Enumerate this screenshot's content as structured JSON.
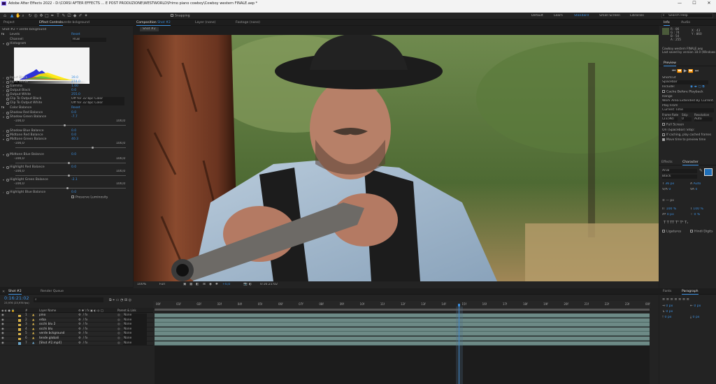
{
  "window": {
    "title": "Adobe After Effects 2022 - D:\\CORSI AFTER EFFECTS ... E POST PRODUZIONE\\WESTWORLD\\Primo piano cowboy\\Cowboy western FINALE.aep *",
    "minimize": "—",
    "maximize": "☐",
    "close": "✕"
  },
  "menu": [
    "File",
    "Edit",
    "Composition",
    "Layer",
    "Effect",
    "Animation",
    "View",
    "Window",
    "Help"
  ],
  "toolbar": {
    "snapping": "Snapping",
    "workspaces": [
      "Default",
      "Learn",
      "Standard",
      "Small Screen",
      "Libraries"
    ],
    "search_placeholder": "Search Help"
  },
  "left": {
    "tabs": [
      "Project",
      "Effect Controls",
      "verde bckground"
    ],
    "header": "Shot #2 • verde bckground",
    "effect_levels": "Levels",
    "reset": "Reset",
    "channel_label": "Channel:",
    "channel_value": "RGB",
    "histogram_label": "Histogram",
    "rows": [
      {
        "label": "Input Black",
        "value": "39.0"
      },
      {
        "label": "Input White",
        "value": "274.0"
      },
      {
        "label": "Gamma",
        "value": "1.00"
      },
      {
        "label": "Output Black",
        "value": "0.0"
      },
      {
        "label": "Output White",
        "value": "255.0"
      },
      {
        "label": "Clip To Output Black",
        "value": "Off for 32 bpc Color"
      },
      {
        "label": "Clip To Output White",
        "value": "Off for 32 bpc Color"
      }
    ],
    "effect_color_balance": "Color Balance",
    "reset2": "Reset",
    "cb_rows": [
      {
        "label": "Shadow Red Balance",
        "value": "0.0"
      },
      {
        "label": "Shadow Green Balance",
        "value": "-7.7"
      },
      {
        "label": "Shadow Blue Balance",
        "value": "0.0"
      },
      {
        "label": "Midtone Red Balance",
        "value": "0.0"
      },
      {
        "label": "Midtone Green Balance",
        "value": "40.3"
      },
      {
        "label": "Midtone Blue Balance",
        "value": "0.0"
      },
      {
        "label": "Highlight Red Balance",
        "value": "0.0"
      },
      {
        "label": "Highlight Green Balance",
        "value": "-2.1"
      },
      {
        "label": "Highlight Blue Balance",
        "value": "0.0"
      }
    ],
    "min": "-100,0",
    "max": "100,0",
    "preserve": "Preserve Luminosity"
  },
  "comp": {
    "tabs": [
      "Composition",
      "Shot #2",
      "Layer (none)",
      "Footage (none)"
    ],
    "subtab": "Shot #2",
    "zoom": "100%",
    "res": "Full",
    "timecode": "0:16:21:02",
    "exposure": "+0,0"
  },
  "right": {
    "info_tabs": [
      "Info",
      "Audio"
    ],
    "info_lines": [
      "R : 86",
      "G : 74",
      "B : 54",
      "A : 255"
    ],
    "xy": [
      "X : 43",
      "Y : 860"
    ],
    "file": "Cowboy western FINALE.aep",
    "saved": "Last saved by version 18.0 (Windows 6",
    "preview_tab": "Preview",
    "shortcut_label": "Shortcut",
    "shortcut": "Spacebar",
    "include": "Include:",
    "cache": "Cache Before Playback",
    "range_label": "Range",
    "range": "Work Area Extended By Current...",
    "playfrom_label": "Play From",
    "playfrom": "Current Time",
    "fr_label": "Frame Rate",
    "skip_label": "Skip",
    "resolution_label": "Resolution",
    "fr": "(23,98)",
    "skip": "0",
    "resolution": "Auto",
    "fullscreen": "Full Screen",
    "stop_label": "On (Spacebar) Stop:",
    "stop1": "If caching, play cached frames",
    "stop2": "Move time to preview time",
    "char_tabs": [
      "Effects",
      "Character"
    ],
    "font": "Arial",
    "style": "Black",
    "size": "36 px",
    "leading": "Auto",
    "kerning": "0",
    "tracking": "0",
    "unit": "— px",
    "scale_v": "100 %",
    "scale_h": "100 %",
    "baseline": "0 px",
    "tsume": "0 %",
    "ligatures": "Ligatures",
    "hindi": "Hindi Digits",
    "para_tabs": [
      "Fonts",
      "Paragraph"
    ],
    "para_vals": [
      "0 px",
      "0 px",
      "0 px",
      "0 px",
      "0 px"
    ]
  },
  "timeline": {
    "tabs": [
      "Shot #2",
      "Render Queue"
    ],
    "timecode": "0:16:21:02",
    "fps": "23,976 (23,976 fps)",
    "col_layer": "Layer Name",
    "col_parent": "Parent & Link",
    "layers": [
      {
        "num": "1",
        "name": "pino",
        "color": "#d8b24a",
        "parent": "None"
      },
      {
        "num": "2",
        "name": "erba",
        "color": "#d8b24a",
        "parent": "None"
      },
      {
        "num": "3",
        "name": "occhi blu 2",
        "color": "#d8b24a",
        "parent": "None"
      },
      {
        "num": "4",
        "name": "occhi blu",
        "color": "#d8b24a",
        "parent": "None"
      },
      {
        "num": "5",
        "name": "verde bckground",
        "color": "#d8b24a",
        "parent": "None"
      },
      {
        "num": "6",
        "name": "tende globali",
        "color": "#d8b24a",
        "parent": "None"
      },
      {
        "num": "7",
        "name": "[Shot #2.mp4]",
        "color": "#6aa5c9",
        "parent": "None"
      }
    ],
    "ruler": [
      "00f",
      "01f",
      "02f",
      "03f",
      "04f",
      "05f",
      "06f",
      "07f",
      "08f",
      "09f",
      "10f",
      "11f",
      "12f",
      "13f",
      "14f",
      "15f",
      "16f",
      "17f",
      "18f",
      "19f",
      "20f",
      "21f",
      "22f",
      "23f",
      "00f"
    ]
  }
}
